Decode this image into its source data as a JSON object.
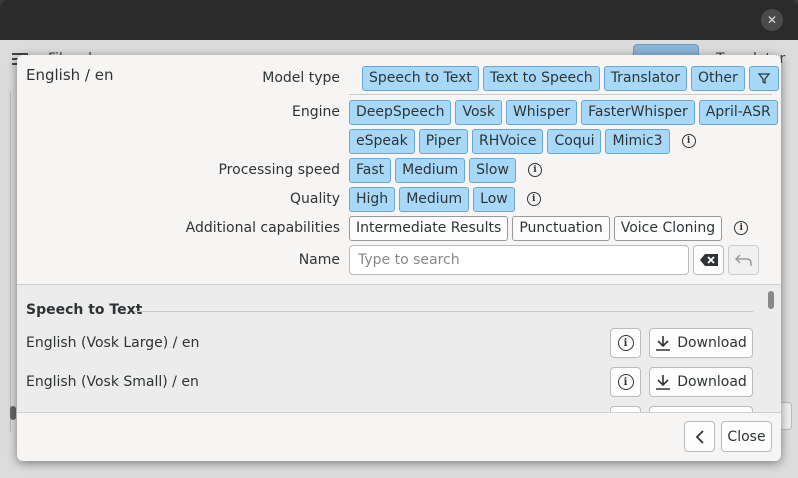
{
  "window": {
    "close_glyph": "✕",
    "app_title": "Files de",
    "tab_active": "",
    "tab_other": "Translator"
  },
  "dialog": {
    "title": "English / en",
    "filters": {
      "model_type": {
        "label": "Model type",
        "options": [
          "Speech to Text",
          "Text to Speech",
          "Translator",
          "Other"
        ],
        "selected": [
          true,
          true,
          true,
          true
        ],
        "filter_icon": "filter-icon"
      },
      "engine": {
        "label": "Engine",
        "row1": [
          "DeepSpeech",
          "Vosk",
          "Whisper",
          "FasterWhisper",
          "April-ASR"
        ],
        "row2": [
          "eSpeak",
          "Piper",
          "RHVoice",
          "Coqui",
          "Mimic3"
        ]
      },
      "processing_speed": {
        "label": "Processing speed",
        "options": [
          "Fast",
          "Medium",
          "Slow"
        ]
      },
      "quality": {
        "label": "Quality",
        "options": [
          "High",
          "Medium",
          "Low"
        ]
      },
      "additional_capabilities": {
        "label": "Additional capabilities",
        "options": [
          "Intermediate Results",
          "Punctuation",
          "Voice Cloning"
        ]
      },
      "name": {
        "label": "Name",
        "placeholder": "Type to search",
        "value": ""
      }
    },
    "list": {
      "section_title": "Speech to Text",
      "models": [
        {
          "name": "English (Vosk Large) / en",
          "download_label": "Download"
        },
        {
          "name": "English (Vosk Small) / en",
          "download_label": "Download"
        }
      ]
    },
    "footer": {
      "close_label": "Close"
    }
  },
  "colors": {
    "chip_selected": "#a8d8f8",
    "chip_selected_border": "#69a7d1",
    "titlebar": "#2b2b2b"
  }
}
